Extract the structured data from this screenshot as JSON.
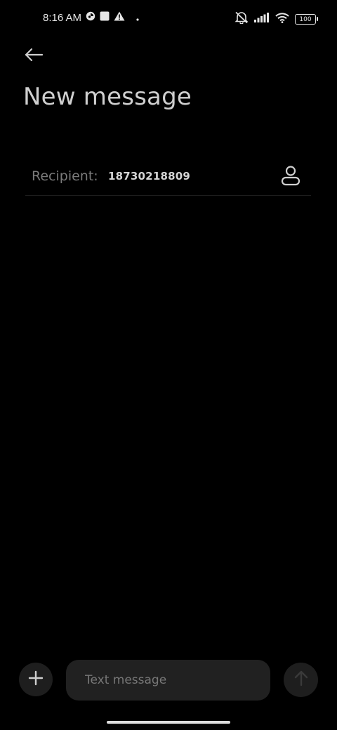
{
  "status_bar": {
    "time": "8:16 AM",
    "battery_level": "100",
    "icons": [
      "vpn-key-icon",
      "square-icon",
      "warning-icon",
      "dot-icon",
      "mute-icon",
      "signal-icon",
      "wifi-icon",
      "battery-icon"
    ]
  },
  "header": {
    "back_icon": "arrow-left-icon",
    "title": "New message"
  },
  "recipient": {
    "label": "Recipient:",
    "value": "18730218809",
    "contact_icon": "person-icon"
  },
  "composer": {
    "attach_icon": "plus-icon",
    "placeholder": "Text message",
    "value": "",
    "send_icon": "arrow-up-icon"
  },
  "colors": {
    "background": "#000000",
    "text_primary": "#cfcfcf",
    "text_secondary": "#7a7a7a",
    "input_background": "#212121",
    "button_background": "#1e1e1e"
  }
}
